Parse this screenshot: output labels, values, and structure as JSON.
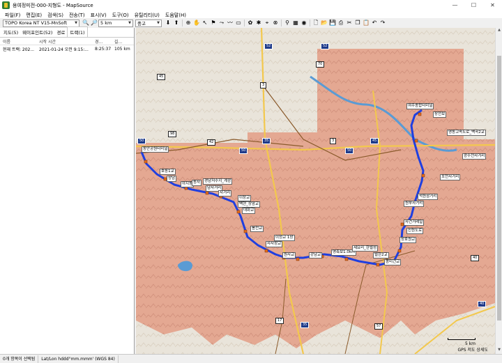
{
  "window": {
    "title": "용여정미전-000-지형도 - MapSource",
    "minimize": "—",
    "maximize": "☐",
    "close": "✕"
  },
  "menu": [
    "파일(F)",
    "편집(E)",
    "검색(S)",
    "전송(T)",
    "표시(V)",
    "도구(O)",
    "유틸리티(U)",
    "도움말(H)"
  ],
  "toolbar": {
    "map_product": "TOPO Korea NT V15-MnSoft",
    "zoom_scale": "5 km",
    "detail_level": "중고"
  },
  "left_panel": {
    "tabs": [
      "지도(5)",
      "웨이포인트(52)",
      "경로",
      "트랙(1)"
    ],
    "active_tab": 3,
    "columns": [
      "이름",
      "시작 시간",
      "경...",
      "길..."
    ],
    "rows": [
      {
        "name": "현재 트랙: 202...",
        "start": "2021-01-24 오전 9:15:...",
        "duration": "8:25:37",
        "length": "105 km"
      }
    ]
  },
  "map": {
    "scale_label": "5 km",
    "caption": "GPS 저도 상세도",
    "waypoints": [
      "동안공원터미널",
      "호동1교",
      "상남",
      "아지동",
      "동사",
      "경남저수지_계광",
      "남사거리",
      "사계외",
      "산남",
      "신두지교",
      "박사교",
      "사거리",
      "이장교",
      "백현_상암교",
      "대화교",
      "봉천교",
      "이정교 1장",
      "사사장교",
      "경한1교",
      "대조교",
      "원사교",
      "봉화교",
      "강남교",
      "우시교_발산교",
      "강대로_정산교",
      "광흥교",
      "황색교",
      "영축보1.0km",
      "세요리_한벌성",
      "벌한2교",
      "종미건교",
      "외공교",
      "장호원교",
      "진원도로",
      "포천사거리",
      "사건거레일",
      "원부사거리",
      "석원삼거리",
      "경천사거리",
      "한주천_산남",
      "광수천사거리",
      "양백교",
      "영동고속도로_백곡2교",
      "장전보",
      "여주종합터미널"
    ],
    "highways": [
      "50",
      "35",
      "45",
      "40",
      "52",
      "3",
      "42",
      "37"
    ],
    "routes": [
      "50",
      "35",
      "98",
      "3",
      "42",
      "45",
      "70",
      "52",
      "38",
      "84",
      "17",
      "57",
      "40",
      "60"
    ]
  },
  "status": {
    "selection": "0개 항목이 선택됨",
    "coord_format": "Lat/Lon hddd°mm.mmm' (WGS 84)"
  },
  "colors": {
    "forest": "#e4a58e",
    "terrain": "#e9e4da",
    "track": "#1f3fe0",
    "water": "#5a9bd4",
    "expressway_badge": "#1e3a8a"
  }
}
